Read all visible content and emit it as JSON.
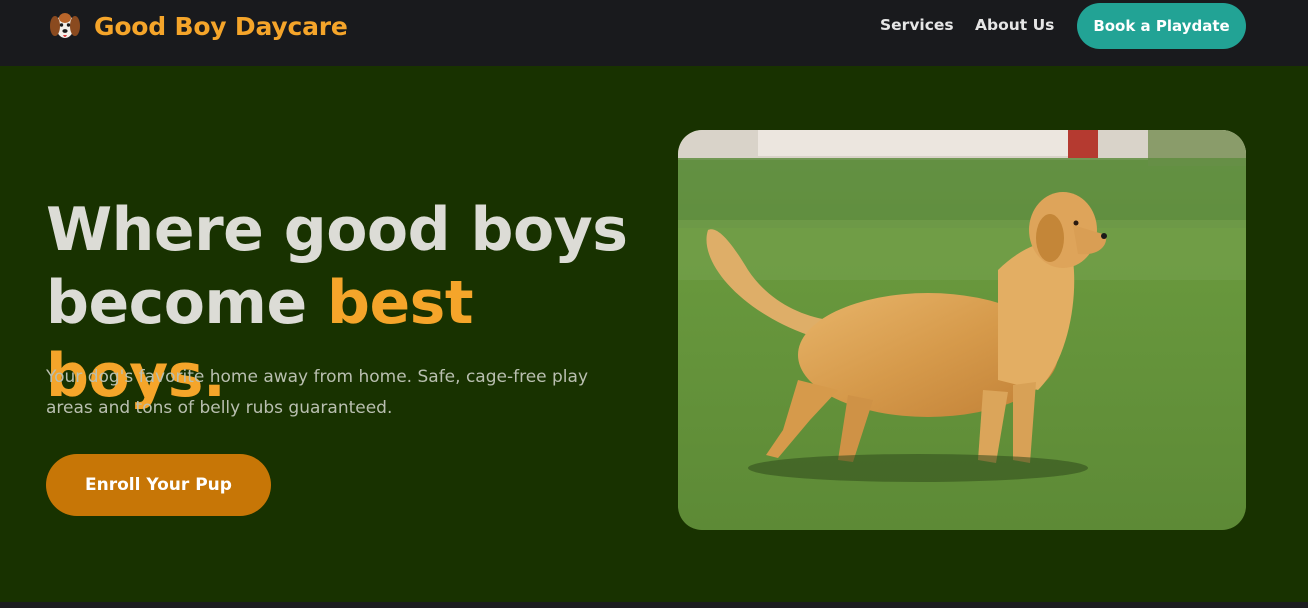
{
  "nav": {
    "brand_name": "Good Boy Daycare",
    "logo_icon": "dog-face-icon",
    "links": [
      {
        "label": "Services"
      },
      {
        "label": "About Us"
      }
    ],
    "cta_label": "Book a Playdate"
  },
  "hero": {
    "headline_part1": "Where good boys become ",
    "headline_accent": "best boys.",
    "subtitle": "Your dog's favorite home away from home. Safe, cage-free play areas and tons of belly rubs guaranteed.",
    "button_label": "Enroll Your Pup",
    "image_subject": "golden retriever standing on grass"
  },
  "colors": {
    "nav_bg": "#191a1d",
    "hero_bg": "#183200",
    "accent_orange": "#f5a52a",
    "teal": "#22a395",
    "button_orange": "#c77606",
    "headline_text": "#dcdcd6"
  }
}
